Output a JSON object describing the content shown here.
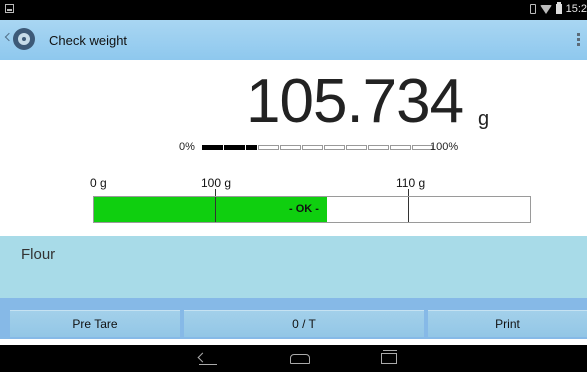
{
  "status_bar": {
    "time": "15:2"
  },
  "action_bar": {
    "title": "Check weight"
  },
  "weight": {
    "value": "105.734",
    "unit": "g"
  },
  "capacity": {
    "min_label": "0%",
    "max_label": "100%",
    "filled_segments": 3,
    "total_segments": 11
  },
  "checkweigh": {
    "labels": [
      "0 g",
      "100 g",
      "110 g"
    ],
    "status": "- OK -",
    "status_color": "#0fcf0f",
    "lower_limit_g": 100,
    "upper_limit_g": 110,
    "current_g": 105.734
  },
  "product": {
    "name": "Flour"
  },
  "buttons": {
    "pretare": "Pre Tare",
    "zero_tare": "0 / T",
    "print": "Print"
  }
}
